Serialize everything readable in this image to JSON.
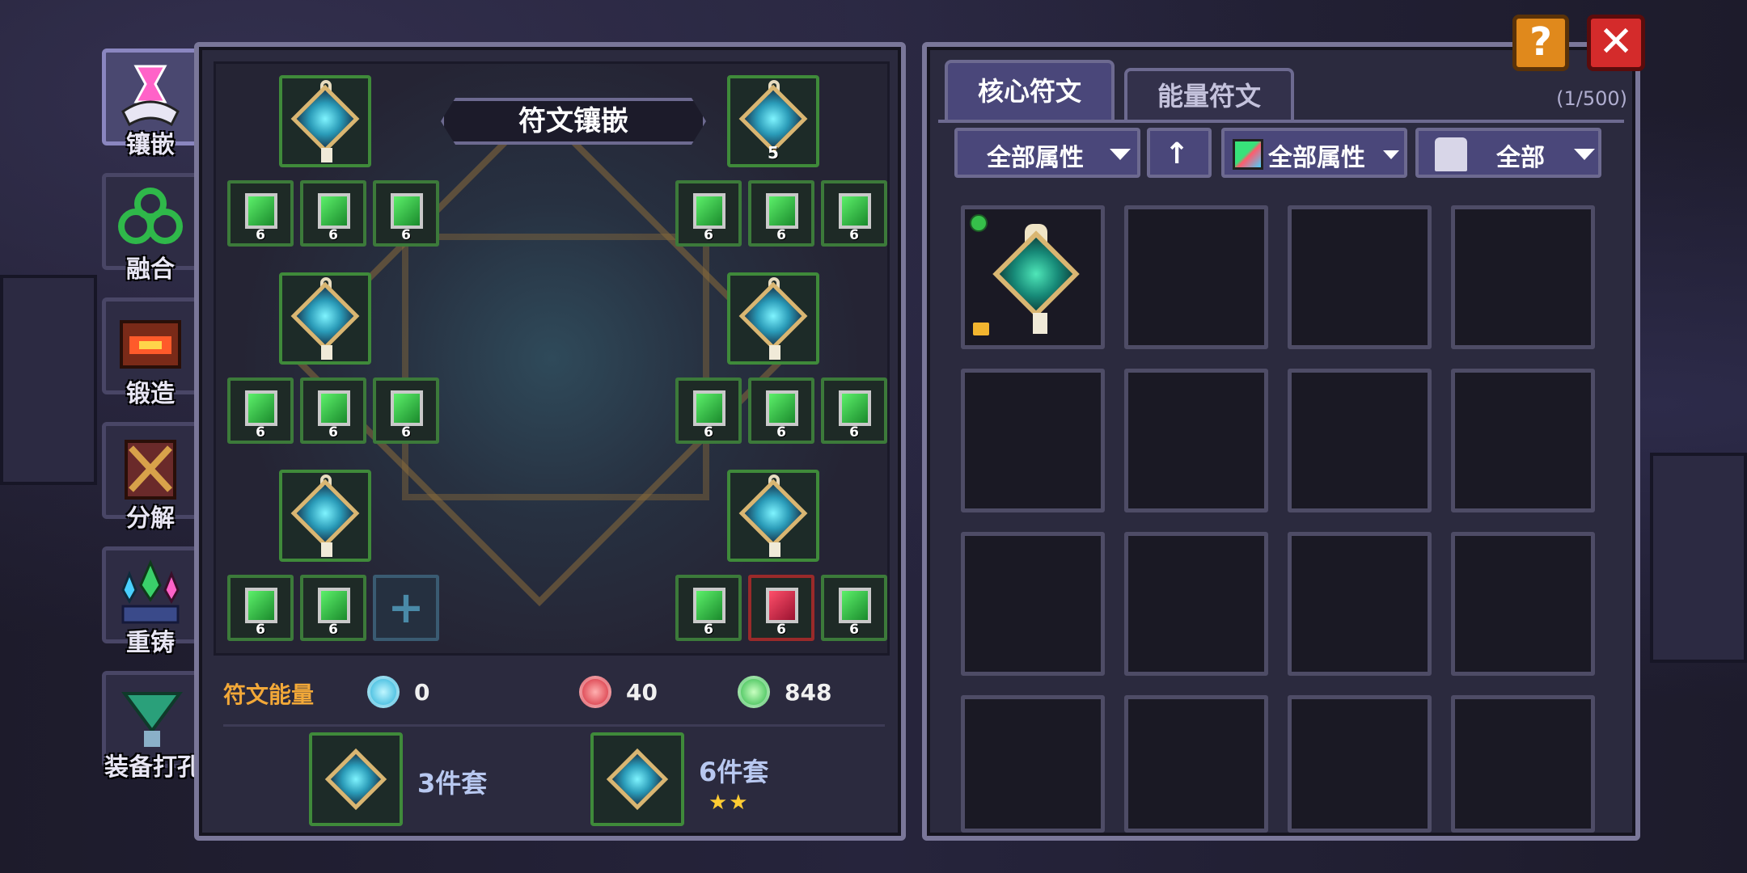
{
  "side_menu": [
    {
      "label": "镶嵌",
      "icon": "embed-icon",
      "active": true
    },
    {
      "label": "融合",
      "icon": "fuse-icon",
      "active": false
    },
    {
      "label": "锻造",
      "icon": "forge-icon",
      "active": false
    },
    {
      "label": "分解",
      "icon": "dismantle-icon",
      "active": false
    },
    {
      "label": "重铸",
      "icon": "recast-icon",
      "active": false
    },
    {
      "label": "装备打孔",
      "icon": "socket-icon",
      "active": false
    }
  ],
  "board": {
    "title": "符文镶嵌",
    "core_slots": [
      {
        "num": ""
      },
      {
        "num": "5"
      },
      {
        "num": ""
      },
      {
        "num": ""
      },
      {
        "num": ""
      },
      {
        "num": ""
      }
    ],
    "rune_level": "6"
  },
  "energy": {
    "label": "符文能量",
    "blue": "0",
    "red": "40",
    "green": "848"
  },
  "sets": {
    "three": "3件套",
    "six": "6件套",
    "six_stars": "★★"
  },
  "right": {
    "tab_core": "核心符文",
    "tab_energy": "能量符文",
    "count": "(1/500)",
    "filter_attr": "全部属性",
    "filter_sort_icon": "up-arrow-icon",
    "filter_color_attr": "全部属性",
    "filter_monster": "全部"
  },
  "buttons": {
    "help": "?",
    "close": "✕"
  },
  "colors": {
    "accent_orange": "#f2a838",
    "panel_border": "#7a7799",
    "slot_green": "#3f8a3a",
    "slot_red": "#9a2a2a"
  }
}
